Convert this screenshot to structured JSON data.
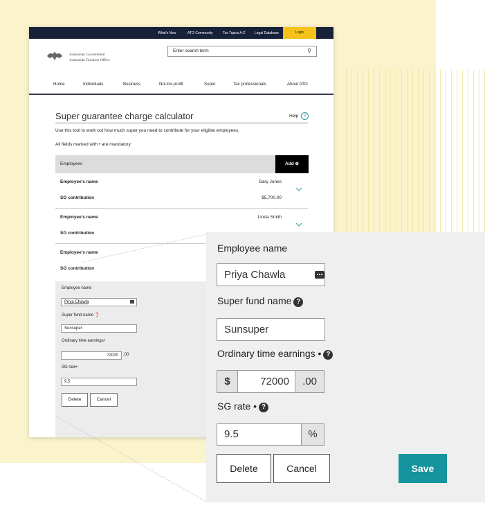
{
  "topbar": {
    "links": [
      "What's New",
      "ATO Community",
      "Tax Topics A-Z",
      "Legal Database"
    ],
    "login": "Login"
  },
  "header": {
    "gov_line1": "Australian Government",
    "gov_line2": "Australian Taxation Office",
    "search_placeholder": "Enter search term"
  },
  "nav": [
    "Home",
    "Individuals",
    "Business",
    "Not-for-profit",
    "Super",
    "Tax professionals",
    "About ATO"
  ],
  "calculator": {
    "title": "Super guarantee charge calculator",
    "help": "Help",
    "intro": "Use this tool to work out how much super you need to contribute for your eligible employees.",
    "mandatory_note": "All fields marked with • are mandatory",
    "employees_header": "Employees",
    "add_label": "Add",
    "rows": [
      {
        "name_label": "Employee's name",
        "name": "Gary Jones",
        "sg_label": "SG contribution",
        "sg": "$5,700.00"
      },
      {
        "name_label": "Employee's name",
        "name": "Linda Smith",
        "sg_label": "SG contribution",
        "sg": ""
      },
      {
        "name_label": "Employee's name",
        "name": "",
        "sg_label": "SG contribution",
        "sg": ""
      }
    ]
  },
  "form": {
    "employee_name_label": "Employee name",
    "employee_name": "Priya Chawla",
    "super_fund_label": "Super fund name",
    "super_fund": "Sunsuper",
    "ote_label": "Ordinary time earnings",
    "currency": "$",
    "ote_value": "72000",
    "ote_cents": ".00",
    "sg_rate_label": "SG rate",
    "sg_rate": "9.5",
    "percent": "%",
    "delete": "Delete",
    "cancel": "Cancel",
    "save": "Save",
    "mandatory_mark": "•"
  },
  "colors": {
    "accent": "#15939e",
    "topbar": "#17223a",
    "login": "#f4c21b",
    "background": "#fbf3cc"
  }
}
